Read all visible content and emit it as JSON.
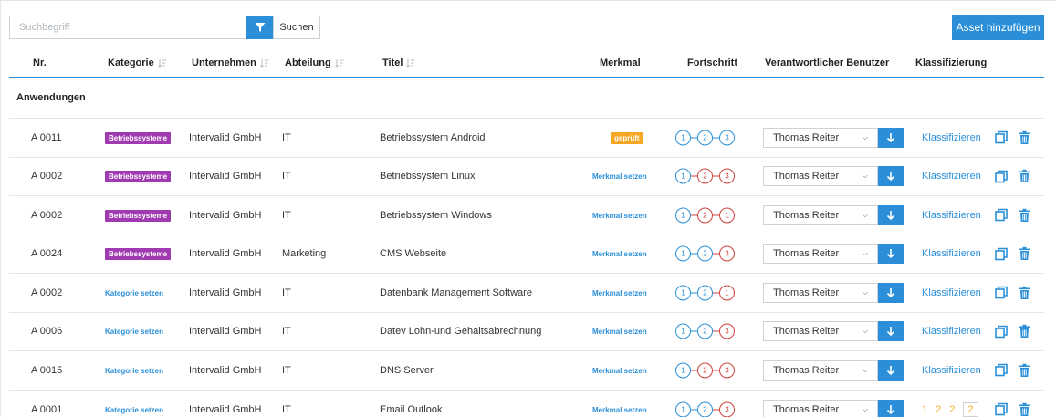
{
  "search": {
    "placeholder": "Suchbegriff",
    "button_label": "Suchen"
  },
  "toolbar": {
    "add_asset_label": "Asset hinzufügen"
  },
  "columns": {
    "nr": "Nr.",
    "kategorie": "Kategorie",
    "unternehmen": "Unternehmen",
    "abteilung": "Abteilung",
    "titel": "Titel",
    "merkmal": "Merkmal",
    "fortschritt": "Fortschritt",
    "verantwortlich": "Verantwortlicher Benutzer",
    "klassifizierung": "Klassifizierung"
  },
  "group": {
    "title": "Anwendungen"
  },
  "colors": {
    "accent": "#2a8fd8",
    "category_badge": "#a03ab1",
    "merkmal_badge": "#f5a623",
    "step_warning": "#d0413a"
  },
  "rows": [
    {
      "nr": "A 0011",
      "kategorie": "Betriebssysteme",
      "kategorie_set": true,
      "unternehmen": "Intervalid GmbH",
      "abteilung": "IT",
      "titel": "Betriebssystem Android",
      "merkmal": "geprüft",
      "merkmal_set": true,
      "steps": [
        "blue",
        "blue",
        "blue"
      ],
      "step_labels": [
        "1",
        "2",
        "3"
      ],
      "user": "Thomas Reiter",
      "klass": "Klassifizieren"
    },
    {
      "nr": "A 0002",
      "kategorie": "Betriebssysteme",
      "kategorie_set": true,
      "unternehmen": "Intervalid GmbH",
      "abteilung": "IT",
      "titel": "Betriebssystem Linux",
      "merkmal": "Merkmal setzen",
      "merkmal_set": false,
      "steps": [
        "blue",
        "red",
        "red"
      ],
      "step_labels": [
        "1",
        "2",
        "3"
      ],
      "user": "Thomas Reiter",
      "klass": "Klassifizieren"
    },
    {
      "nr": "A 0002",
      "kategorie": "Betriebssysteme",
      "kategorie_set": true,
      "unternehmen": "Intervalid GmbH",
      "abteilung": "IT",
      "titel": "Betriebssystem Windows",
      "merkmal": "Merkmal setzen",
      "merkmal_set": false,
      "steps": [
        "blue",
        "red",
        "red"
      ],
      "step_labels": [
        "1",
        "2",
        "1"
      ],
      "user": "Thomas Reiter",
      "klass": "Klassifizieren"
    },
    {
      "nr": "A 0024",
      "kategorie": "Betriebssysteme",
      "kategorie_set": true,
      "unternehmen": "Intervalid GmbH",
      "abteilung": "Marketing",
      "titel": "CMS Webseite",
      "merkmal": "Merkmal setzen",
      "merkmal_set": false,
      "steps": [
        "blue",
        "blue",
        "red"
      ],
      "step_labels": [
        "1",
        "2",
        "3"
      ],
      "user": "Thomas Reiter",
      "klass": "Klassifizieren"
    },
    {
      "nr": "A 0002",
      "kategorie": "Kategorie setzen",
      "kategorie_set": false,
      "unternehmen": "Intervalid GmbH",
      "abteilung": "IT",
      "titel": "Datenbank Management Software",
      "merkmal": "Merkmal setzen",
      "merkmal_set": false,
      "steps": [
        "blue",
        "blue",
        "red"
      ],
      "step_labels": [
        "1",
        "2",
        "1"
      ],
      "user": "Thomas Reiter",
      "klass": "Klassifizieren"
    },
    {
      "nr": "A 0006",
      "kategorie": "Kategorie setzen",
      "kategorie_set": false,
      "unternehmen": "Intervalid GmbH",
      "abteilung": "IT",
      "titel": "Datev Lohn-und Gehaltsabrechnung",
      "merkmal": "Merkmal setzen",
      "merkmal_set": false,
      "steps": [
        "blue",
        "blue",
        "red"
      ],
      "step_labels": [
        "1",
        "2",
        "3"
      ],
      "user": "Thomas Reiter",
      "klass": "Klassifizieren"
    },
    {
      "nr": "A 0015",
      "kategorie": "Kategorie setzen",
      "kategorie_set": false,
      "unternehmen": "Intervalid GmbH",
      "abteilung": "IT",
      "titel": "DNS Server",
      "merkmal": "Merkmal setzen",
      "merkmal_set": false,
      "steps": [
        "blue",
        "red",
        "red"
      ],
      "step_labels": [
        "1",
        "2",
        "3"
      ],
      "user": "Thomas Reiter",
      "klass": "Klassifizieren"
    },
    {
      "nr": "A 0001",
      "kategorie": "Kategorie setzen",
      "kategorie_set": false,
      "unternehmen": "Intervalid GmbH",
      "abteilung": "IT",
      "titel": "Email Outlook",
      "merkmal": "Merkmal setzen",
      "merkmal_set": false,
      "steps": [
        "blue",
        "blue",
        "red"
      ],
      "step_labels": [
        "1",
        "2",
        "3"
      ],
      "user": "Thomas Reiter",
      "klass_numbers": [
        "1",
        "2",
        "2",
        "2"
      ]
    }
  ]
}
